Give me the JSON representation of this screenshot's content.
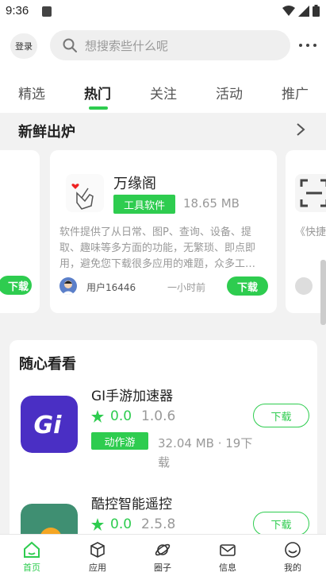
{
  "status": {
    "time": "9:36"
  },
  "top": {
    "login_label": "登录",
    "search_placeholder": "想搜索些什么呢"
  },
  "tabs": [
    {
      "label": "精选",
      "active": false
    },
    {
      "label": "热门",
      "active": true
    },
    {
      "label": "关注",
      "active": false
    },
    {
      "label": "活动",
      "active": false
    },
    {
      "label": "推广",
      "active": false
    }
  ],
  "fresh": {
    "title": "新鲜出炉",
    "left_card": {
      "download_label": "下载"
    },
    "main_card": {
      "name": "万缘阁",
      "tag": "工具软件",
      "size": "18.65 MB",
      "description": "软件提供了从日常、图P、查询、设备、提取、趣味等多方面的功能，无繁琐、即点即用，避免您下载很多应用的难题，众多工…",
      "user": "用户16446",
      "time": "一小时前",
      "download_label": "下载"
    },
    "right_card": {
      "description": "《快捷置扫一…"
    }
  },
  "random": {
    "title": "随心看看",
    "apps": [
      {
        "name": "GI手游加速器",
        "score": "0.0",
        "version": "1.0.6",
        "tag": "动作游",
        "meta": "32.04 MB · 19下载",
        "download_label": "下载"
      },
      {
        "name": "酷控智能遥控",
        "score": "0.0",
        "version": "2.5.8",
        "download_label": "下载"
      }
    ]
  },
  "nav": [
    {
      "label": "首页",
      "active": true
    },
    {
      "label": "应用",
      "active": false
    },
    {
      "label": "圈子",
      "active": false
    },
    {
      "label": "信息",
      "active": false
    },
    {
      "label": "我的",
      "active": false
    }
  ],
  "colors": {
    "accent": "#2ecc4f",
    "gi_logo": "#4a2fc4",
    "remote_logo": "#3f8f72"
  }
}
